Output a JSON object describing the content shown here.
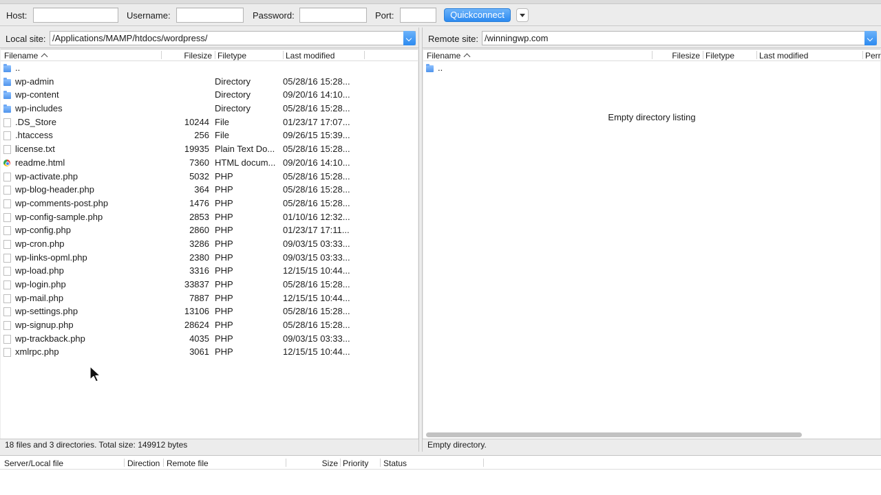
{
  "quickconnect": {
    "host_label": "Host:",
    "host_value": "",
    "username_label": "Username:",
    "username_value": "",
    "password_label": "Password:",
    "password_value": "",
    "port_label": "Port:",
    "port_value": "",
    "connect_label": "Quickconnect"
  },
  "local": {
    "site_label": "Local site:",
    "site_path": "/Applications/MAMP/htdocs/wordpress/",
    "columns": {
      "filename": "Filename",
      "filesize": "Filesize",
      "filetype": "Filetype",
      "modified": "Last modified"
    },
    "files": [
      {
        "name": "..",
        "size": "",
        "type": "",
        "modified": "",
        "icon": "folder"
      },
      {
        "name": "wp-admin",
        "size": "",
        "type": "Directory",
        "modified": "05/28/16 15:28...",
        "icon": "folder"
      },
      {
        "name": "wp-content",
        "size": "",
        "type": "Directory",
        "modified": "09/20/16 14:10...",
        "icon": "folder"
      },
      {
        "name": "wp-includes",
        "size": "",
        "type": "Directory",
        "modified": "05/28/16 15:28...",
        "icon": "folder"
      },
      {
        "name": ".DS_Store",
        "size": "10244",
        "type": "File",
        "modified": "01/23/17 17:07...",
        "icon": "file"
      },
      {
        "name": ".htaccess",
        "size": "256",
        "type": "File",
        "modified": "09/26/15 15:39...",
        "icon": "file"
      },
      {
        "name": "license.txt",
        "size": "19935",
        "type": "Plain Text Do...",
        "modified": "05/28/16 15:28...",
        "icon": "file"
      },
      {
        "name": "readme.html",
        "size": "7360",
        "type": "HTML docum...",
        "modified": "09/20/16 14:10...",
        "icon": "html"
      },
      {
        "name": "wp-activate.php",
        "size": "5032",
        "type": "PHP",
        "modified": "05/28/16 15:28...",
        "icon": "file"
      },
      {
        "name": "wp-blog-header.php",
        "size": "364",
        "type": "PHP",
        "modified": "05/28/16 15:28...",
        "icon": "file"
      },
      {
        "name": "wp-comments-post.php",
        "size": "1476",
        "type": "PHP",
        "modified": "05/28/16 15:28...",
        "icon": "file"
      },
      {
        "name": "wp-config-sample.php",
        "size": "2853",
        "type": "PHP",
        "modified": "01/10/16 12:32...",
        "icon": "file"
      },
      {
        "name": "wp-config.php",
        "size": "2860",
        "type": "PHP",
        "modified": "01/23/17 17:11...",
        "icon": "file"
      },
      {
        "name": "wp-cron.php",
        "size": "3286",
        "type": "PHP",
        "modified": "09/03/15 03:33...",
        "icon": "file"
      },
      {
        "name": "wp-links-opml.php",
        "size": "2380",
        "type": "PHP",
        "modified": "09/03/15 03:33...",
        "icon": "file"
      },
      {
        "name": "wp-load.php",
        "size": "3316",
        "type": "PHP",
        "modified": "12/15/15 10:44...",
        "icon": "file"
      },
      {
        "name": "wp-login.php",
        "size": "33837",
        "type": "PHP",
        "modified": "05/28/16 15:28...",
        "icon": "file"
      },
      {
        "name": "wp-mail.php",
        "size": "7887",
        "type": "PHP",
        "modified": "12/15/15 10:44...",
        "icon": "file"
      },
      {
        "name": "wp-settings.php",
        "size": "13106",
        "type": "PHP",
        "modified": "05/28/16 15:28...",
        "icon": "file"
      },
      {
        "name": "wp-signup.php",
        "size": "28624",
        "type": "PHP",
        "modified": "05/28/16 15:28...",
        "icon": "file"
      },
      {
        "name": "wp-trackback.php",
        "size": "4035",
        "type": "PHP",
        "modified": "09/03/15 03:33...",
        "icon": "file"
      },
      {
        "name": "xmlrpc.php",
        "size": "3061",
        "type": "PHP",
        "modified": "12/15/15 10:44...",
        "icon": "file"
      }
    ],
    "status": "18 files and 3 directories. Total size: 149912 bytes"
  },
  "remote": {
    "site_label": "Remote site:",
    "site_path": "/winningwp.com",
    "columns": {
      "filename": "Filename",
      "filesize": "Filesize",
      "filetype": "Filetype",
      "modified": "Last modified",
      "perm": "Perr"
    },
    "files": [
      {
        "name": "..",
        "icon": "folder"
      }
    ],
    "empty_message": "Empty directory listing",
    "status": "Empty directory."
  },
  "queue": {
    "columns": {
      "server_local": "Server/Local file",
      "direction": "Direction",
      "remote_file": "Remote file",
      "size": "Size",
      "priority": "Priority",
      "status": "Status"
    }
  },
  "colors": {
    "accent": "#2c8af0",
    "folder": "#4f94ec"
  }
}
